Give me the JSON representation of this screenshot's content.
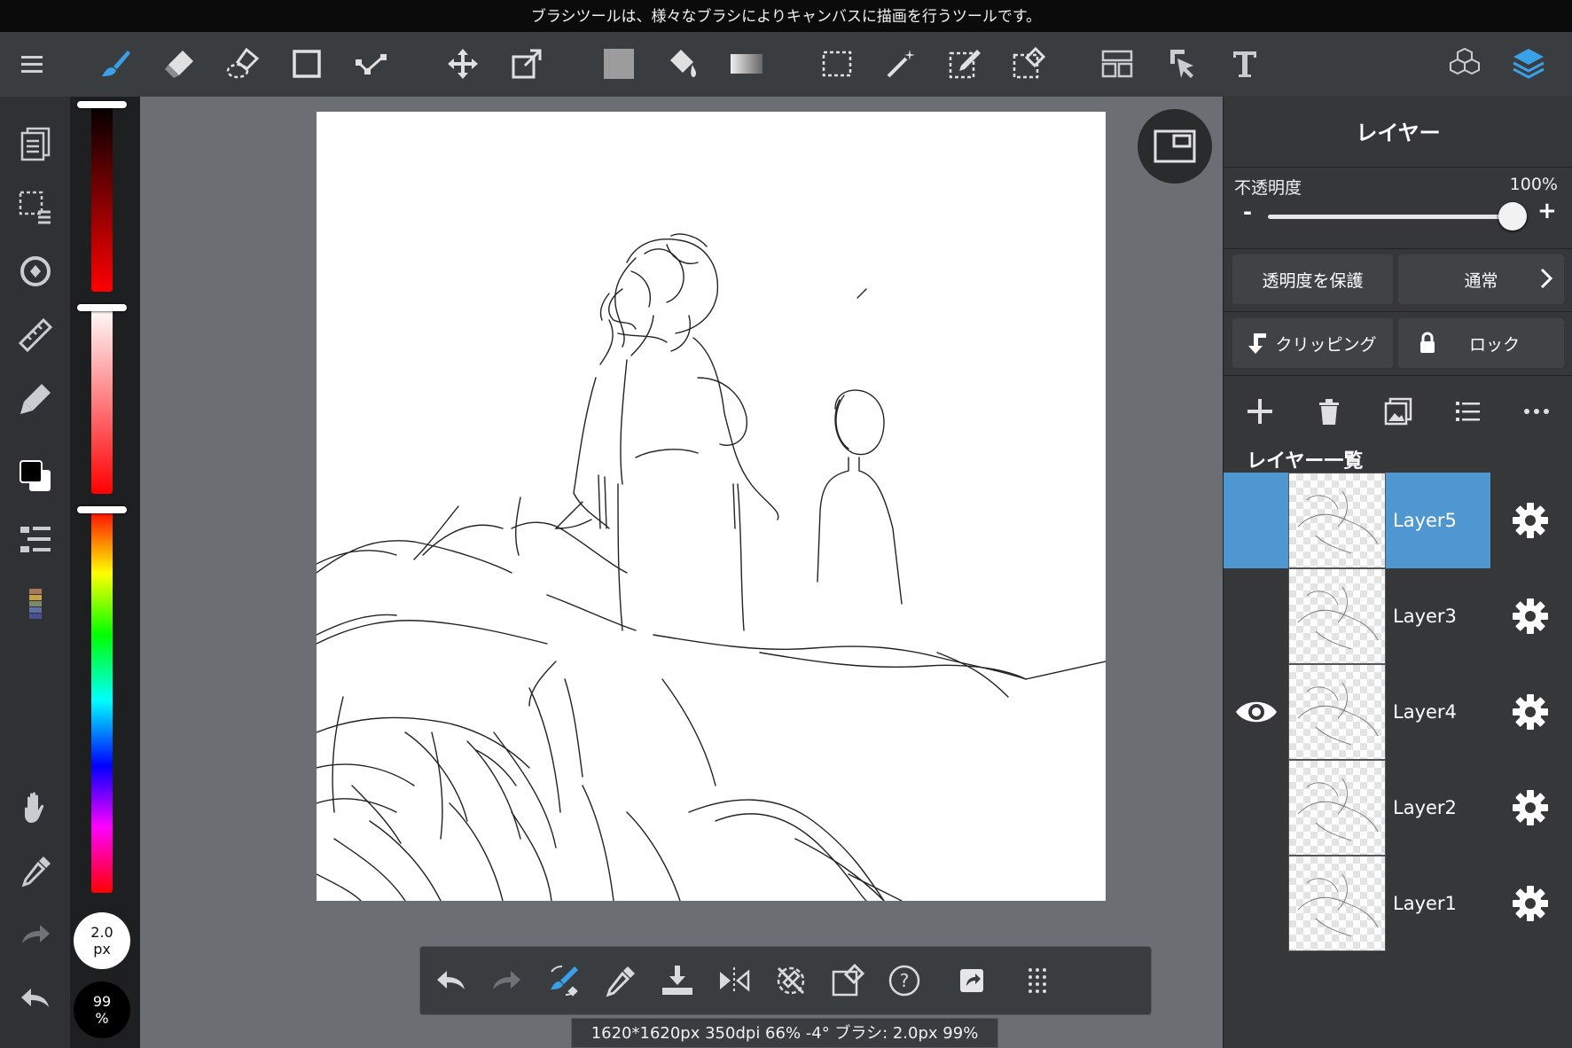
{
  "hint": "ブラシツールは、様々なブラシによりキャンバスに描画を行うツールです。",
  "toolbar": {
    "tools": [
      "menu",
      "brush",
      "eraser",
      "smudge",
      "shape",
      "vector",
      "move",
      "transform",
      "fill-color",
      "bucket",
      "gradient",
      "select-rect",
      "magic-wand",
      "select-pen",
      "select-eraser",
      "frame-divider",
      "operation",
      "text"
    ],
    "right": [
      "material",
      "layers"
    ]
  },
  "left_tools": [
    "page",
    "selection-layer",
    "filter",
    "ruler",
    "snap",
    "color",
    "layer-list",
    "palette",
    "hand",
    "eyedropper",
    "redo",
    "undo"
  ],
  "color": {
    "current": "#000000",
    "secondary": "#ffffff",
    "brush_size_value": "2.0",
    "brush_size_unit": "px",
    "opacity_value": "99",
    "opacity_unit": "%"
  },
  "bottom_toolbar": [
    "undo",
    "redo",
    "brush-transform",
    "eyedropper",
    "save",
    "flip",
    "rotate-reset",
    "edit",
    "help",
    "share",
    "more"
  ],
  "status": "1620*1620px 350dpi 66% -4° ブラシ: 2.0px 99%",
  "panel": {
    "title": "レイヤー",
    "opacity_label": "不透明度",
    "opacity_value": "100%",
    "opacity_level": 1.0,
    "minus": "-",
    "plus": "+",
    "protect_alpha": "透明度を保護",
    "blend_mode": "通常",
    "clipping": "クリッピング",
    "lock": "ロック",
    "list_title": "レイヤー一覧",
    "layers": [
      {
        "name": "Layer5",
        "selected": true,
        "visible_icon": false
      },
      {
        "name": "Layer3",
        "selected": false,
        "visible_icon": false
      },
      {
        "name": "Layer4",
        "selected": false,
        "visible_icon": true
      },
      {
        "name": "Layer2",
        "selected": false,
        "visible_icon": false
      },
      {
        "name": "Layer1",
        "selected": false,
        "visible_icon": false
      }
    ]
  },
  "accent": "#4f97d0",
  "active_tool_color": "#3aa0e8"
}
